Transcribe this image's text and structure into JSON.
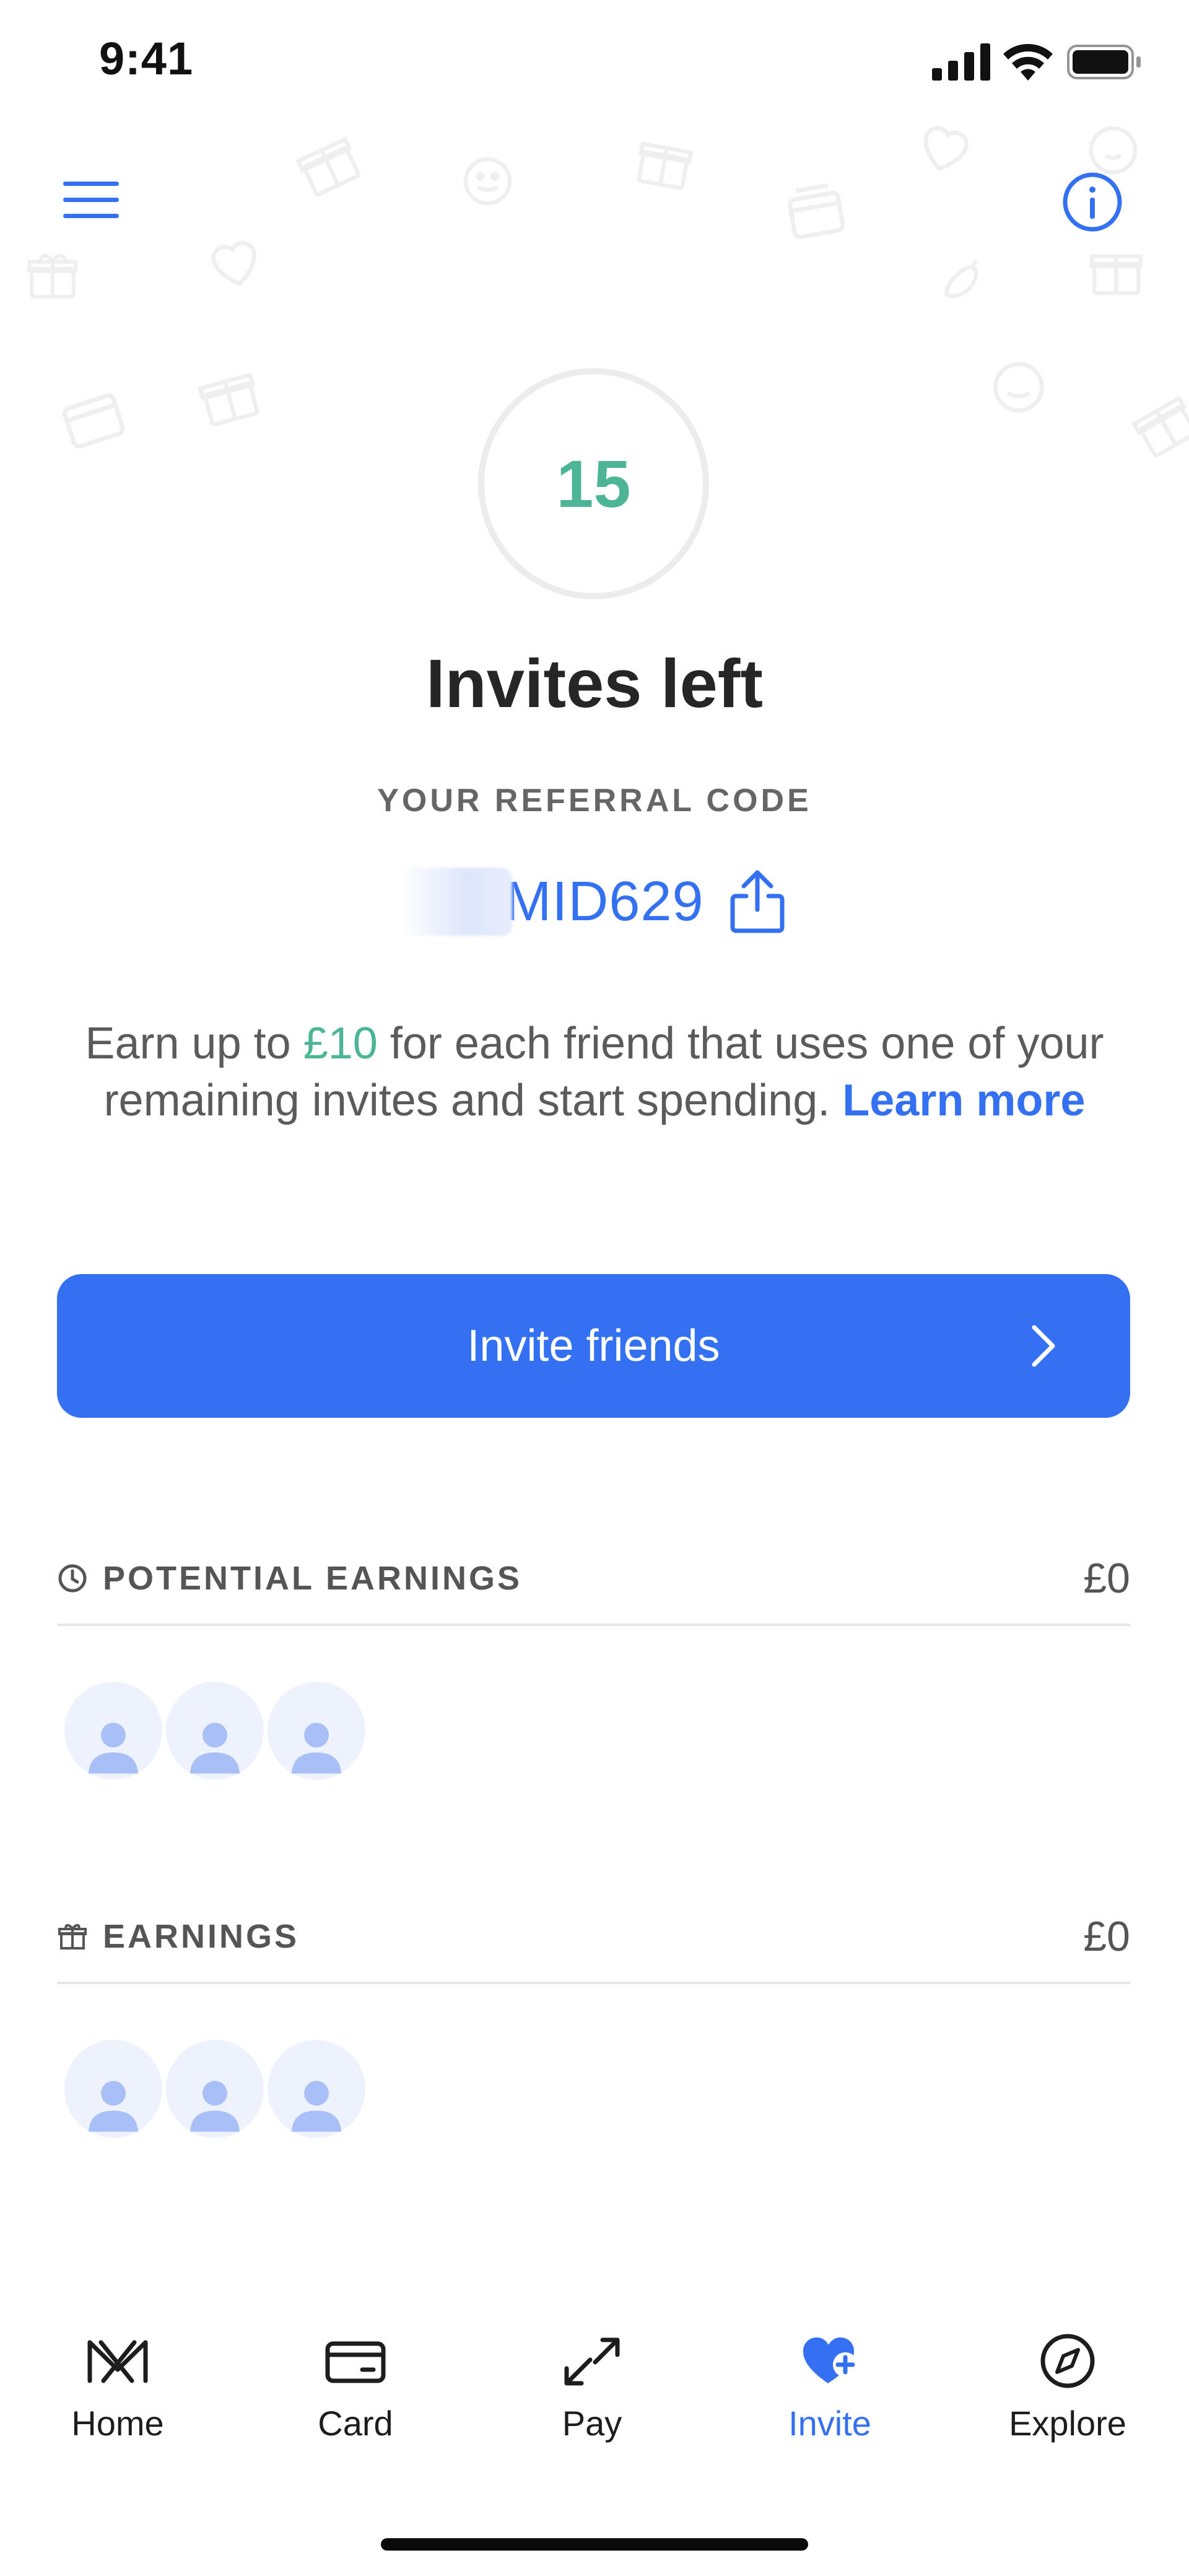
{
  "status_bar": {
    "time": "9:41"
  },
  "header": {
    "menu_icon": "hamburger-menu-icon",
    "info_icon": "info-icon"
  },
  "invites": {
    "count": "15",
    "title": "Invites left"
  },
  "referral": {
    "label": "YOUR REFERRAL CODE",
    "code": "MID629",
    "share_icon": "share-icon"
  },
  "description": {
    "before": "Earn up to ",
    "amount": "£10",
    "after": " for each friend that uses one of your remaining invites and start spending. ",
    "link": "Learn more"
  },
  "invite_button": {
    "label": "Invite friends"
  },
  "potential_earnings": {
    "title": "POTENTIAL EARNINGS",
    "value": "£0",
    "icon": "clock-icon",
    "avatar_count": 3
  },
  "earnings": {
    "title": "EARNINGS",
    "value": "£0",
    "icon": "gift-icon",
    "avatar_count": 3
  },
  "tabs": [
    {
      "label": "Home",
      "icon": "monzo-logo-icon",
      "active": false
    },
    {
      "label": "Card",
      "icon": "card-icon",
      "active": false
    },
    {
      "label": "Pay",
      "icon": "transfer-arrows-icon",
      "active": false
    },
    {
      "label": "Invite",
      "icon": "heart-plus-icon",
      "active": true
    },
    {
      "label": "Explore",
      "icon": "compass-icon",
      "active": false
    }
  ],
  "colors": {
    "accent": "#3470f2",
    "positive": "#4bb596",
    "muted_text": "#5b5b5b"
  }
}
